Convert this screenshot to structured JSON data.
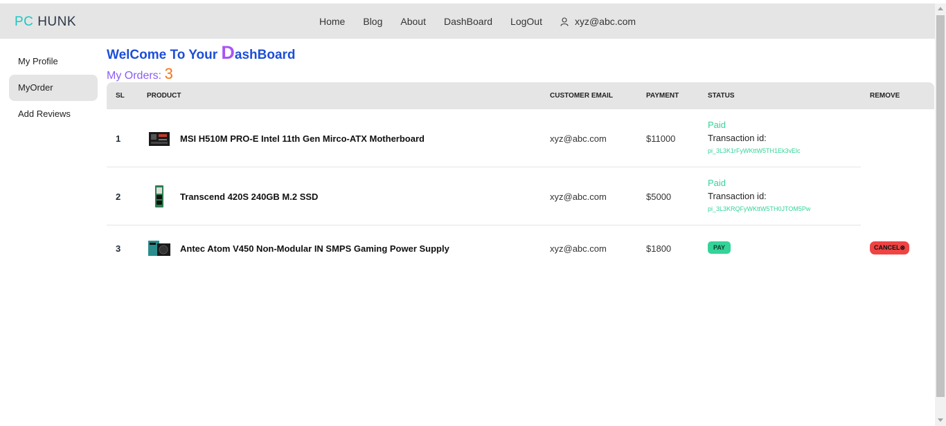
{
  "brand": {
    "part1": "PC",
    "part2": "HUNK",
    "accent_color": "#1fc7c0"
  },
  "nav": {
    "links": [
      "Home",
      "Blog",
      "About",
      "DashBoard",
      "LogOut"
    ],
    "user_email": "xyz@abc.com",
    "user_icon": "user-icon"
  },
  "sidebar": {
    "items": [
      {
        "label": "My Profile",
        "active": false
      },
      {
        "label": "MyOrder",
        "active": true
      },
      {
        "label": "Add Reviews",
        "active": false
      }
    ]
  },
  "main": {
    "welcome_part1": "WelCome To Your ",
    "welcome_big": "D",
    "welcome_part2": "ashBoard",
    "orders_label": "My Orders: ",
    "orders_count": "3"
  },
  "table": {
    "headers": {
      "sl": "SL",
      "product": "PRODUCT",
      "email": "CUSTOMER EMAIL",
      "payment": "PAYMENT",
      "status": "STATUS",
      "remove": "REMOVE"
    },
    "rows": [
      {
        "sl": "1",
        "product": "MSI H510M PRO-E Intel 11th Gen Mirco-ATX Motherboard",
        "email": "xyz@abc.com",
        "payment": "$11000",
        "status": "Paid",
        "tx_label": "Transaction id:",
        "tx_id": "pi_3L3K1rFyWKttW5TH1Ek3vElc",
        "image": "motherboard-image"
      },
      {
        "sl": "2",
        "product": "Transcend 420S 240GB M.2 SSD",
        "email": "xyz@abc.com",
        "payment": "$5000",
        "status": "Paid",
        "tx_label": "Transaction id:",
        "tx_id": "pi_3L3KRQFyWKttW5TH0JTOM5Pw",
        "image": "ssd-image"
      },
      {
        "sl": "3",
        "product": "Antec Atom V450 Non-Modular IN SMPS Gaming Power Supply",
        "email": "xyz@abc.com",
        "payment": "$1800",
        "pay_label": "PAY",
        "cancel_label": "CANCEL⊗",
        "image": "power-supply-image"
      }
    ]
  }
}
